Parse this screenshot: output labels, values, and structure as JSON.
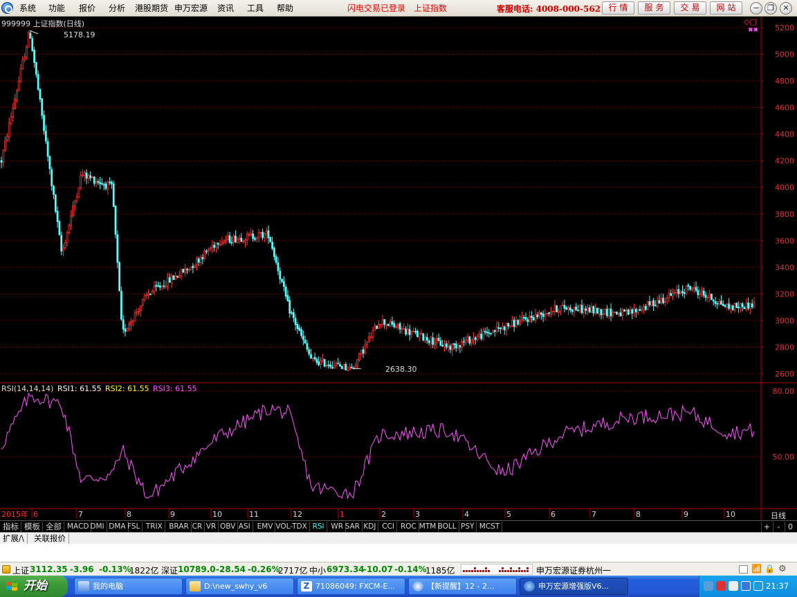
{
  "colors": {
    "up": "#ff3333",
    "down": "#54ffff",
    "grid": "#800000",
    "axis": "#b00000",
    "rsi1": "#ffffff",
    "rsi2": "#ffff00",
    "rsi3": "#ff55ff",
    "tab_active": "#33ffff",
    "status_up": "#cc0000",
    "status_down": "#008800"
  },
  "menu": {
    "items": [
      "系统",
      "功能",
      "报价",
      "分析",
      "港股期货",
      "申万宏源",
      "资讯",
      "工具",
      "帮助"
    ],
    "status_flash": "闪电交易已登录",
    "status_index": "上证指数",
    "hotline": "客服电话: 4008-000-562",
    "buttons": [
      "行情",
      "服务",
      "交易",
      "网站"
    ]
  },
  "chart": {
    "symbol_label": "999999 上证指数(日线)",
    "corner_icons": "◇□",
    "high_label": "5178.19",
    "low_label": "2638.30",
    "price_ticks": [
      2600,
      2800,
      3000,
      3200,
      3400,
      3600,
      3800,
      4000,
      4200,
      4400,
      4600,
      4800,
      5000,
      5200
    ],
    "rsi_header": {
      "name": "RSI(14,14,14)",
      "rsi1": "RSI1: 61.55",
      "rsi2": "RSI2: 61.55",
      "rsi3": "RSI3: 61.55"
    },
    "rsi_ticks": [
      "80.00",
      "50.00"
    ],
    "period_label": "日线",
    "date_labels": [
      {
        "text": "2015年",
        "red": true
      },
      {
        "text": "6",
        "red": true
      },
      {
        "text": "7",
        "red": false
      },
      {
        "text": "8",
        "red": false
      },
      {
        "text": "9",
        "red": false
      },
      {
        "text": "10",
        "red": false
      },
      {
        "text": "11",
        "red": false
      },
      {
        "text": "12",
        "red": false
      },
      {
        "text": "1",
        "red": true
      },
      {
        "text": "2",
        "red": false
      },
      {
        "text": "3",
        "red": false
      },
      {
        "text": "4",
        "red": false
      },
      {
        "text": "5",
        "red": false
      },
      {
        "text": "6",
        "red": false
      },
      {
        "text": "7",
        "red": false
      },
      {
        "text": "8",
        "red": false
      },
      {
        "text": "9",
        "red": false
      },
      {
        "text": "10",
        "red": false
      }
    ]
  },
  "chart_data": {
    "type": "line",
    "title": "999999 上证指数(日线)",
    "xlabel": "",
    "ylabel": "",
    "ylim": [
      2600,
      5200
    ],
    "x": [
      "2015-05-20",
      "2015-06-12",
      "2015-07-08",
      "2015-07-24",
      "2015-08-18",
      "2015-08-26",
      "2015-09-16",
      "2015-10-20",
      "2015-11-12",
      "2015-12-23",
      "2016-01-08",
      "2016-01-27",
      "2016-02-29",
      "2016-03-22",
      "2016-05-18",
      "2016-06-30",
      "2016-08-16",
      "2016-10-10",
      "2016-11-29",
      "2016-12-30",
      "2017-01-20"
    ],
    "series": [
      {
        "name": "",
        "values": [
          4200,
          5178.19,
          3500,
          4100,
          4000,
          2900,
          3200,
          3400,
          3600,
          3650,
          3100,
          2700,
          2638.3,
          3000,
          2800,
          2950,
          3100,
          3050,
          3250,
          3100,
          3120
        ]
      }
    ],
    "rsi": {
      "name": "RSI(14,14,14)",
      "ylim": [
        30,
        80
      ],
      "values": [
        55,
        78,
        74,
        39,
        42,
        53,
        31,
        48,
        59,
        72,
        70,
        36,
        33,
        60,
        62,
        42,
        60,
        68,
        70,
        61,
        62
      ]
    },
    "legend": "top-left"
  },
  "tabs": {
    "items": [
      "指标",
      "模板",
      "全部",
      "MACD",
      "DMI",
      "DMA",
      "FSL",
      "TRIX",
      "BRAR",
      "CR",
      "VR",
      "OBV",
      "ASI",
      "EMV",
      "VOL-TDX",
      "RSI",
      "WR",
      "SAR",
      "KDJ",
      "CCI",
      "ROC",
      "MTM",
      "BOLL",
      "PSY",
      "MCST"
    ],
    "active": "RSI",
    "controls": [
      "+",
      "-",
      "0"
    ]
  },
  "ext_tabs": [
    "扩展/\\",
    "关联报价"
  ],
  "status": {
    "sh_label": "上证",
    "sh_value": "3112.35",
    "sh_change": "-3.96",
    "sh_pct": "-0.13%",
    "sh_amount": "1822亿",
    "sz_label": "深证",
    "sz_value": "10789.0",
    "sz_change": "-28.54",
    "sz_pct": "-0.26%",
    "sz_amount": "2717亿",
    "zx_label": "中小",
    "zx_value": "6973.34",
    "zx_change": "-10.07",
    "zx_pct": "-0.14%",
    "zx_amount": "1185亿",
    "broker": "申万宏源证券杭州一"
  },
  "taskbar": {
    "start": "开始",
    "tasks": [
      "我的电脑",
      "D:\\new_swhy_v6",
      "71086049: FXCM-E...",
      "【新提醒】12 - 2...",
      "申万宏源增强版V6..."
    ],
    "clock": "21:37"
  }
}
